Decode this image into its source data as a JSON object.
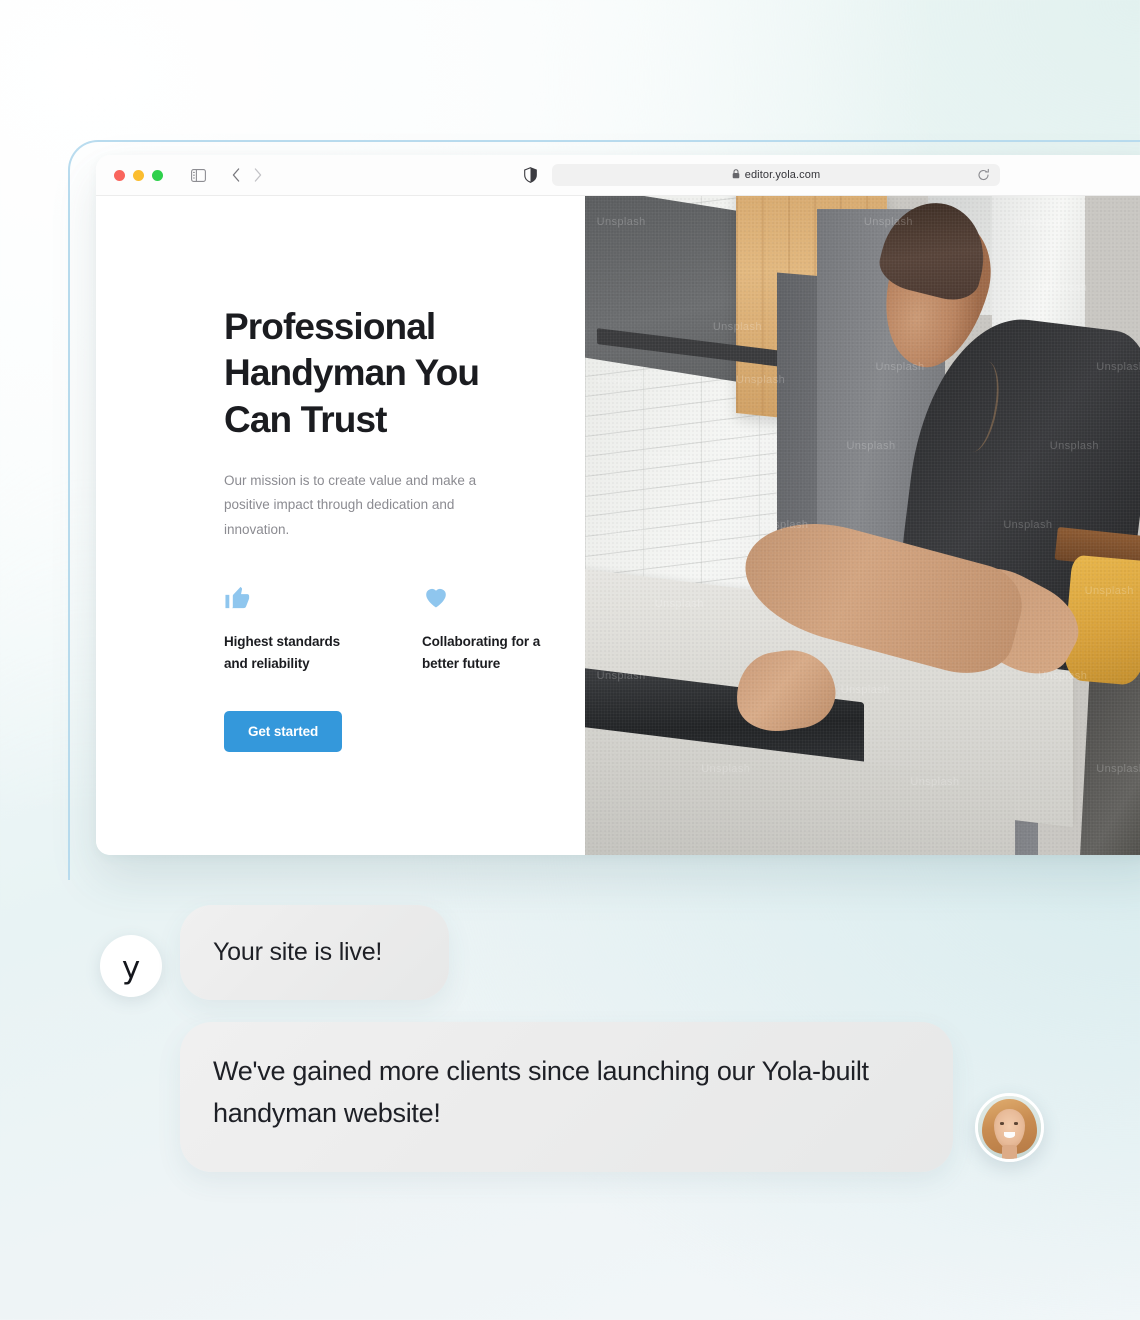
{
  "browser": {
    "url": "editor.yola.com",
    "lock_icon": "lock-icon",
    "reload_icon": "reload-icon",
    "sidebar_icon": "sidebar-toggle-icon",
    "back_icon": "chevron-left-icon",
    "forward_icon": "chevron-right-icon",
    "shield_icon": "privacy-shield-icon",
    "traffic_lights": [
      "close-red",
      "minimize-yellow",
      "zoom-green"
    ]
  },
  "hero": {
    "title": "Professional Handyman You Can Trust",
    "subtitle": "Our mission is to create value and make a positive impact through dedication and innovation.",
    "cta_label": "Get started",
    "features": [
      {
        "icon": "thumbs-up-icon",
        "label": "Highest standards and reliability"
      },
      {
        "icon": "heart-icon",
        "label": "Collaborating for a better future"
      }
    ],
    "photo_alt": "handyman installing a cooktop in a kitchen",
    "photo_watermark": "Unsplash"
  },
  "chat": {
    "brand_avatar_letter": "y",
    "messages": [
      {
        "from": "yola",
        "text": "Your site is live!"
      },
      {
        "from": "user",
        "text": "We've gained more clients since launching our Yola-built handyman website!"
      }
    ],
    "user_avatar": "woman-portrait-avatar"
  },
  "colors": {
    "accent_blue": "#3498db",
    "icon_blue": "#8fc6ee",
    "frame_border": "#b9dcef",
    "bubble_gray": "#ececec",
    "heading": "#1b1c20",
    "body_text": "#8b8b91"
  }
}
